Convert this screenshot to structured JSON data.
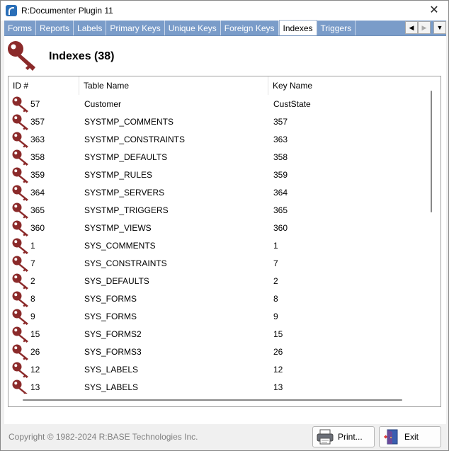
{
  "window": {
    "title": "R:Documenter Plugin 11"
  },
  "tabs": [
    "Forms",
    "Reports",
    "Labels",
    "Primary Keys",
    "Unique Keys",
    "Foreign Keys",
    "Indexes",
    "Triggers"
  ],
  "active_tab": "Indexes",
  "page": {
    "title": "Indexes (38)"
  },
  "grid": {
    "columns": [
      "ID #",
      "Table Name",
      "Key Name"
    ],
    "rows": [
      {
        "id": "57",
        "table": "Customer",
        "key": "CustState"
      },
      {
        "id": "357",
        "table": "SYSTMP_COMMENTS",
        "key": "357"
      },
      {
        "id": "363",
        "table": "SYSTMP_CONSTRAINTS",
        "key": "363"
      },
      {
        "id": "358",
        "table": "SYSTMP_DEFAULTS",
        "key": "358"
      },
      {
        "id": "359",
        "table": "SYSTMP_RULES",
        "key": "359"
      },
      {
        "id": "364",
        "table": "SYSTMP_SERVERS",
        "key": "364"
      },
      {
        "id": "365",
        "table": "SYSTMP_TRIGGERS",
        "key": "365"
      },
      {
        "id": "360",
        "table": "SYSTMP_VIEWS",
        "key": "360"
      },
      {
        "id": "1",
        "table": "SYS_COMMENTS",
        "key": "1"
      },
      {
        "id": "7",
        "table": "SYS_CONSTRAINTS",
        "key": "7"
      },
      {
        "id": "2",
        "table": "SYS_DEFAULTS",
        "key": "2"
      },
      {
        "id": "8",
        "table": "SYS_FORMS",
        "key": "8"
      },
      {
        "id": "9",
        "table": "SYS_FORMS",
        "key": "9"
      },
      {
        "id": "15",
        "table": "SYS_FORMS2",
        "key": "15"
      },
      {
        "id": "26",
        "table": "SYS_FORMS3",
        "key": "26"
      },
      {
        "id": "12",
        "table": "SYS_LABELS",
        "key": "12"
      },
      {
        "id": "13",
        "table": "SYS_LABELS",
        "key": "13"
      }
    ]
  },
  "footer": {
    "copyright": "Copyright © 1982-2024 R:BASE Technologies Inc.",
    "print_label": "Print...",
    "exit_label": "Exit"
  },
  "colors": {
    "tab_strip": "#7a9cc9",
    "key_icon": "#8b2a2a"
  },
  "icons": {
    "row_icon": "key-icon",
    "print": "printer-icon",
    "exit": "exit-door-icon"
  }
}
